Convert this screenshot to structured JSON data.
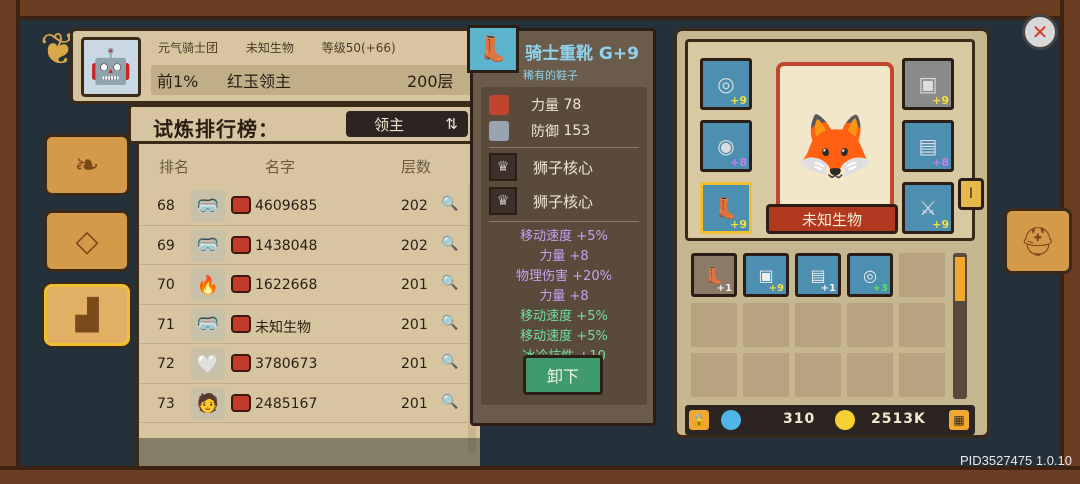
{
  "header": {
    "guild": "元气骑士团",
    "player_name": "未知生物",
    "level": "等级50(+66)",
    "rank_percent": "前1%",
    "title": "红玉领主",
    "floor": "200层"
  },
  "board_title": "试炼排行榜：",
  "mode_selector": "领主",
  "columns": {
    "rank": "排名",
    "name": "名字",
    "floor": "层数"
  },
  "rows": [
    {
      "rank": "68",
      "name": "4609685",
      "floor": "202"
    },
    {
      "rank": "69",
      "name": "1438048",
      "floor": "202"
    },
    {
      "rank": "70",
      "name": "1622668",
      "floor": "201"
    },
    {
      "rank": "71",
      "name": "未知生物",
      "floor": "201"
    },
    {
      "rank": "72",
      "name": "3780673",
      "floor": "201"
    },
    {
      "rank": "73",
      "name": "2485167",
      "floor": "201"
    }
  ],
  "tooltip": {
    "item_name": "骑士重靴 G+9",
    "rarity": "稀有的鞋子",
    "strength_label": "力量",
    "strength_value": "78",
    "defense_label": "防御",
    "defense_value": "153",
    "core1": "狮子核心",
    "core2": "狮子核心",
    "bonus_purple": [
      "移动速度 +5%",
      "力量 +8",
      "物理伤害 +20%",
      "力量 +8"
    ],
    "bonus_green": [
      "移动速度 +5%",
      "移动速度 +5%",
      "冰冷抗性 +10"
    ],
    "unequip": "卸下"
  },
  "equipment": {
    "character_name": "未知生物",
    "slots": [
      {
        "icon": "amulet-icon",
        "level": "+9",
        "color": "#f0e040"
      },
      {
        "icon": "helmet-icon",
        "level": "+9",
        "color": "#f0e040"
      },
      {
        "icon": "ring-icon",
        "level": "+8",
        "color": "#c080f0"
      },
      {
        "icon": "armor-icon",
        "level": "+8",
        "color": "#c080f0"
      },
      {
        "icon": "boots-icon",
        "level": "+9",
        "color": "#f0e040"
      },
      {
        "icon": "weapon-icon",
        "level": "+9",
        "color": "#f0e040"
      }
    ]
  },
  "inventory": [
    {
      "icon": "boots-icon",
      "level": "+1",
      "color": "#f0f0f0"
    },
    {
      "icon": "helmet-icon",
      "level": "+9",
      "color": "#f0e040"
    },
    {
      "icon": "armor-icon",
      "level": "+1",
      "color": "#f0f0f0"
    },
    {
      "icon": "amulet-icon",
      "level": "+3",
      "color": "#60e060"
    }
  ],
  "currency": {
    "gems": "310",
    "gold": "2513K"
  },
  "version": "PID3527475 1.0.10"
}
